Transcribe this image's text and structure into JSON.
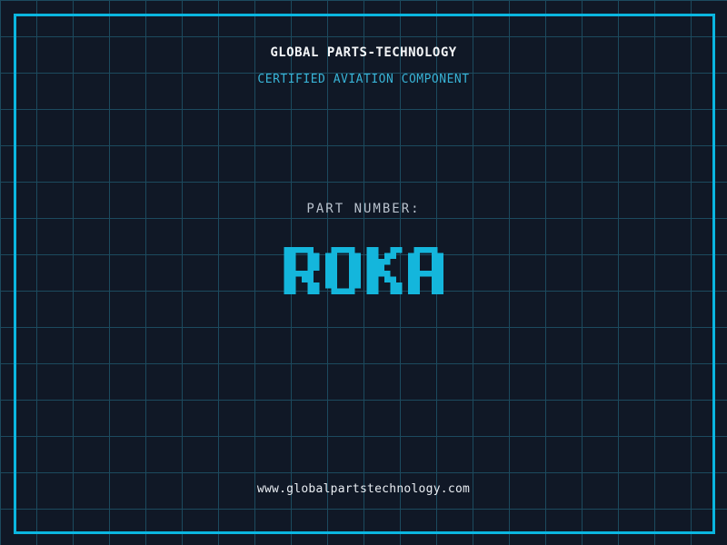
{
  "theme": {
    "background": "#101826",
    "grid_line": "#1c4a5e",
    "frame": "#0ab6e0",
    "heading_text": "#f4f6f8",
    "subtitle_text": "#38b3d6",
    "label_text": "#b9c2cd",
    "part_number_text": "#14b6dc",
    "footer_text": "#e9edf2"
  },
  "header": {
    "company_name": "GLOBAL PARTS-TECHNOLOGY",
    "certification_line": "CERTIFIED AVIATION COMPONENT"
  },
  "part": {
    "label": "PART NUMBER:",
    "number": "ROKA"
  },
  "footer": {
    "website_url": "www.globalpartstechnology.com"
  }
}
